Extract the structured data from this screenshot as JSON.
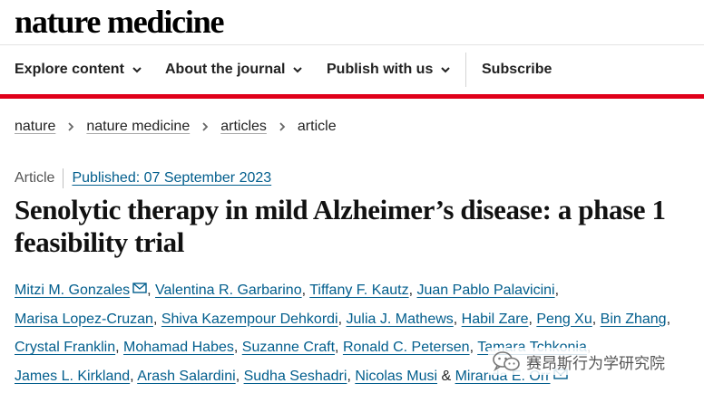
{
  "header": {
    "logo_text": "nature medicine"
  },
  "nav": {
    "items": [
      {
        "label": "Explore content",
        "dropdown": true
      },
      {
        "label": "About the journal",
        "dropdown": true
      },
      {
        "label": "Publish with us",
        "dropdown": true
      },
      {
        "label": "Subscribe",
        "dropdown": false
      }
    ],
    "accent_color": "#e0001a"
  },
  "breadcrumb": {
    "items": [
      "nature",
      "nature medicine",
      "articles",
      "article"
    ]
  },
  "article": {
    "type": "Article",
    "published": "Published: 07 September 2023",
    "title": "Senolytic therapy in mild Alzheimer’s disease: a phase 1 feasibility trial",
    "link_color": "#025e8d",
    "authors": [
      "Mitzi M. Gonzales",
      "Valentina R. Garbarino",
      "Tiffany F. Kautz",
      "Juan Pablo Palavicini",
      "Marisa Lopez-Cruzan",
      "Shiva Kazempour Dehkordi",
      "Julia J. Mathews",
      "Habil Zare",
      "Peng Xu",
      "Bin Zhang",
      "Crystal Franklin",
      "Mohamad Habes",
      "Suzanne Craft",
      "Ronald C. Petersen",
      "Tamara Tchkonia",
      "James L. Kirkland",
      "Arash Salardini",
      "Sudha Seshadri",
      "Nicolas Musi",
      "Miranda E. Orr"
    ],
    "corresponding_icon": "mail-icon",
    "last_separator": "&"
  },
  "watermark": {
    "icon": "wechat-icon",
    "text": "赛昂斯行为学研究院"
  }
}
